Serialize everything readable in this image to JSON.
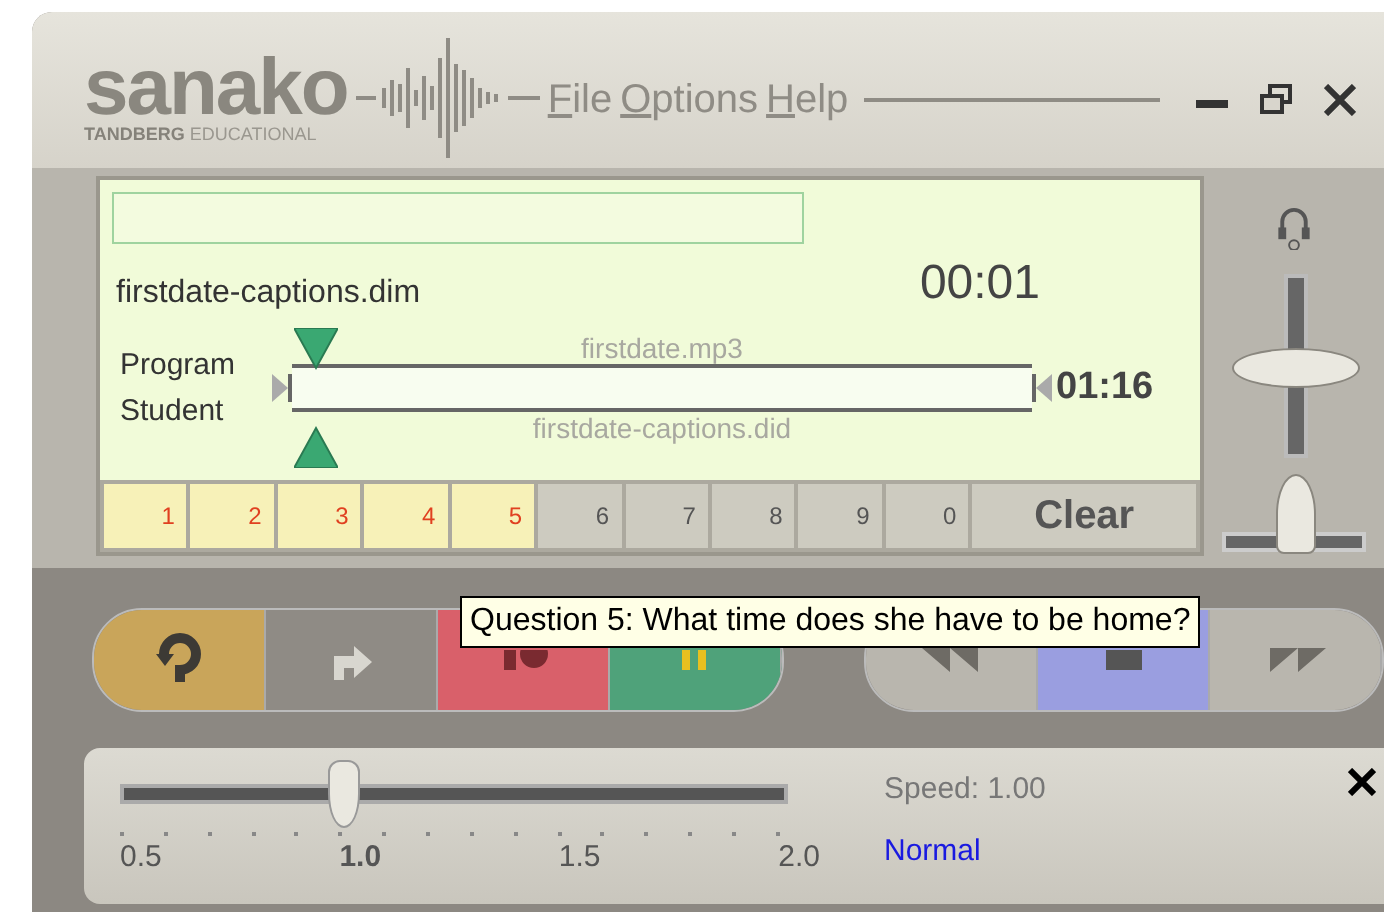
{
  "header": {
    "logo": "sanako",
    "logo_sub_bold": "TANDBERG",
    "logo_sub": "EDUCATIONAL"
  },
  "menu": [
    {
      "label": "File"
    },
    {
      "label": "Options"
    },
    {
      "label": "Help"
    }
  ],
  "display": {
    "file_name": "firstdate-captions.dim",
    "elapsed": "00:01",
    "total": "01:16",
    "tracks": [
      {
        "label": "Program",
        "file": "firstdate.mp3"
      },
      {
        "label": "Student",
        "file": "firstdate-captions.did"
      }
    ],
    "position": {
      "level": 0.02
    },
    "bookmarks": [
      {
        "label": "1",
        "set": true
      },
      {
        "label": "2",
        "set": true
      },
      {
        "label": "3",
        "set": true
      },
      {
        "label": "4",
        "set": true
      },
      {
        "label": "5",
        "set": true
      },
      {
        "label": "6",
        "set": false
      },
      {
        "label": "7",
        "set": false
      },
      {
        "label": "8",
        "set": false
      },
      {
        "label": "9",
        "set": false
      },
      {
        "label": "0",
        "set": false
      }
    ],
    "clear": "Clear"
  },
  "volume": {
    "level": 0.5
  },
  "balance": {
    "level": 0.5
  },
  "transport": [
    {
      "kind": "repeat",
      "color": "#c9a55a"
    },
    {
      "kind": "forward",
      "color": "#8f8b85"
    },
    {
      "kind": "record",
      "color": "#d9606a"
    },
    {
      "kind": "pause",
      "color": "#4fa27a"
    },
    {
      "kind": "rewind",
      "color": "#b9b6ae"
    },
    {
      "kind": "stop",
      "color": "#9a9ee0"
    },
    {
      "kind": "fastforward",
      "color": "#b9b6ae"
    }
  ],
  "tooltip": "Question 5: What time does she have to be home?",
  "speed": {
    "level": 0.333,
    "ticks": [
      {
        "label": "0.5",
        "selected": false
      },
      {
        "label": "1.0",
        "selected": true
      },
      {
        "label": "1.5",
        "selected": false
      },
      {
        "label": "2.0",
        "selected": false
      }
    ],
    "reading": "Speed: 1.00",
    "preset": "Normal"
  }
}
